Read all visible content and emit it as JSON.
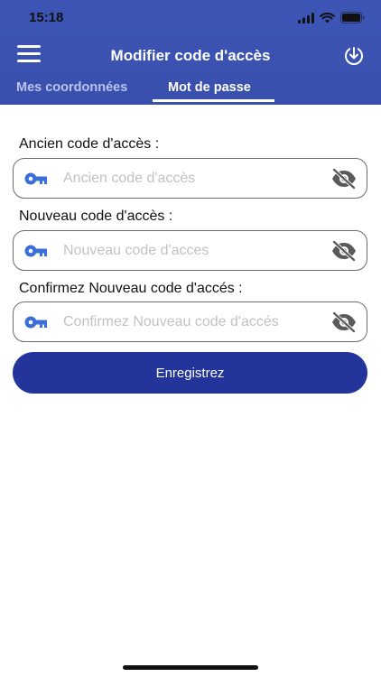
{
  "status_bar": {
    "time": "15:18"
  },
  "header": {
    "title": "Modifier code d'accès",
    "tabs": [
      {
        "label": "Mes coordonnées",
        "active": false
      },
      {
        "label": "Mot de passe",
        "active": true
      }
    ]
  },
  "form": {
    "fields": [
      {
        "label": "Ancien code d'accès :",
        "placeholder": "Ancien code d'accès",
        "value": ""
      },
      {
        "label": "Nouveau code d'accès :",
        "placeholder": "Nouveau code d'acces",
        "value": ""
      },
      {
        "label": "Confirmez Nouveau code d'accés :",
        "placeholder": "Confirmez Nouveau code d'accés",
        "value": ""
      }
    ],
    "submit_label": "Enregistrez"
  },
  "icons": {
    "menu": "hamburger-menu-icon",
    "download": "download-icon",
    "key": "key-icon",
    "eye": "eye-slash-icon"
  },
  "colors": {
    "header": "#3b52b1",
    "button": "#23349a",
    "key_icon": "#3b6fd8",
    "tab_inactive": "#b9c4ec"
  }
}
